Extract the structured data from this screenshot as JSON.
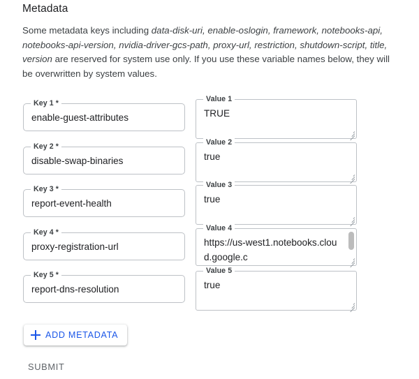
{
  "section": {
    "title": "Metadata",
    "description_prefix": "Some metadata keys including ",
    "reserved_keys": "data-disk-uri, enable-oslogin, framework, notebooks-api, notebooks-api-version, nvidia-driver-gcs-path, proxy-url, restriction, shutdown-script, title, version",
    "description_suffix": " are reserved for system use only. If you use these variable names below, they will be overwritten by system values."
  },
  "colors": {
    "accent_blue": "#1a56e8",
    "border": "#bdc1c6",
    "text": "#202124",
    "muted_text": "#5f6368",
    "scrollbar_thumb": "#bcbcbc"
  },
  "metadata_rows": [
    {
      "key_label": "Key 1 *",
      "key_value": "enable-guest-attributes",
      "value_label": "Value 1",
      "value_value": "TRUE"
    },
    {
      "key_label": "Key 2 *",
      "key_value": "disable-swap-binaries",
      "value_label": "Value 2",
      "value_value": "true"
    },
    {
      "key_label": "Key 3 *",
      "key_value": "report-event-health",
      "value_label": "Value 3",
      "value_value": "true"
    },
    {
      "key_label": "Key 4 *",
      "key_value": "proxy-registration-url",
      "value_label": "Value 4",
      "value_value": "https://us-west1.notebooks.cloud.google.c"
    },
    {
      "key_label": "Key 5 *",
      "key_value": "report-dns-resolution",
      "value_label": "Value 5",
      "value_value": "true"
    }
  ],
  "actions": {
    "add_metadata_label": "ADD METADATA",
    "add_metadata_icon": "plus-icon",
    "submit_label": "SUBMIT"
  }
}
